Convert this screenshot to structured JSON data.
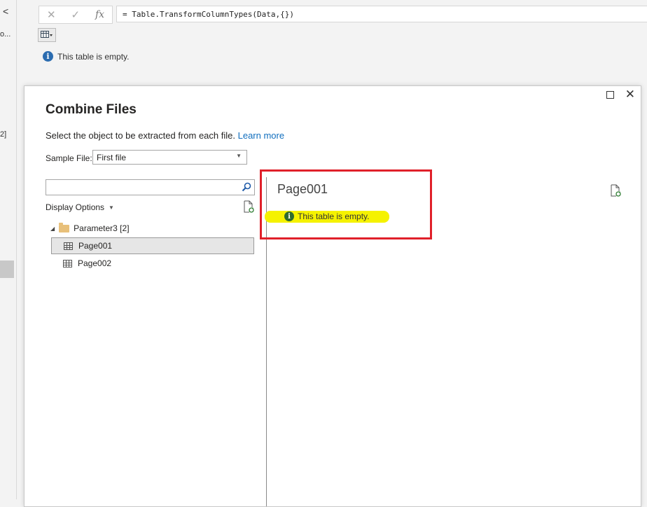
{
  "left_strip": {
    "chevron": "<",
    "truncated_text": "o...",
    "count_text": "2]"
  },
  "formula": {
    "cancel_icon": "close-icon",
    "confirm_icon": "check-icon",
    "fx_label": "fx",
    "expression": "= Table.TransformColumnTypes(Data,{})"
  },
  "status": {
    "message": "This table is empty."
  },
  "dialog": {
    "title": "Combine Files",
    "subtitle": "Select the object to be extracted from each file.",
    "learn_more": "Learn more",
    "sample_file_label": "Sample File:",
    "sample_file_value": "First file",
    "search_value": "",
    "display_options": "Display Options",
    "tree": {
      "folder_label": "Parameter3 [2]",
      "items": [
        {
          "label": "Page001",
          "selected": true
        },
        {
          "label": "Page002",
          "selected": false
        }
      ]
    },
    "preview": {
      "title": "Page001",
      "message": "This table is empty."
    }
  },
  "colors": {
    "accent_link": "#106ebe",
    "highlight": "#f5f200",
    "annotation_box": "#e0202a"
  }
}
